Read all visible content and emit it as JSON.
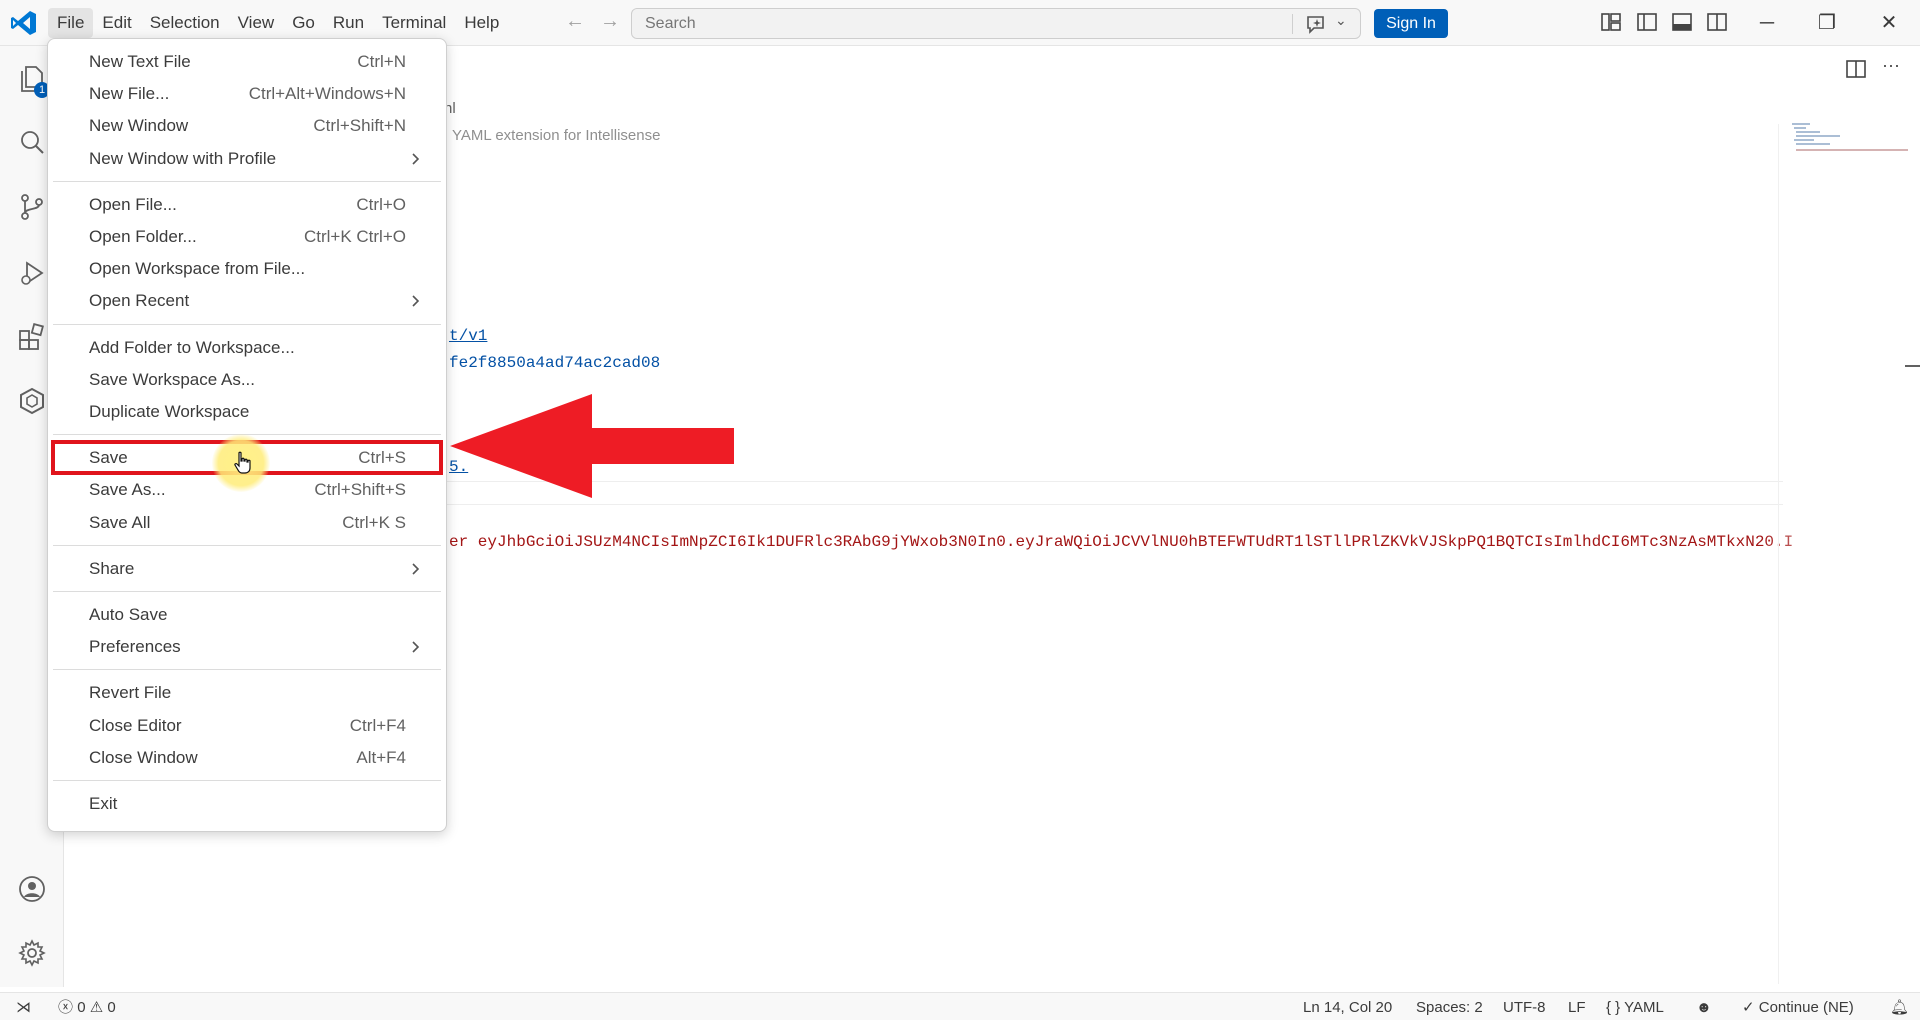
{
  "menubar": [
    "File",
    "Edit",
    "Selection",
    "View",
    "Go",
    "Run",
    "Terminal",
    "Help"
  ],
  "search": {
    "placeholder": "Search"
  },
  "signin_label": "Sign In",
  "activity": {
    "explorer_badge": "1"
  },
  "editor": {
    "breadcrumb": "nl",
    "hint": "YAML extension for Intellisense",
    "lines": [
      {
        "text": "t/v1",
        "kind": "link"
      },
      {
        "text": "fe2f8850a4ad74ac2cad08",
        "kind": "num"
      },
      {
        "text": "5.",
        "kind": "link"
      },
      {
        "text": "er eyJhbGciOiJSUzM4NCIsImNpZCI6Ik1DUFRlc3RAbG9jYWxob3N0In0.eyJraWQiOiJCVVlNU0hBTEFWTUdRT1lSTllPRlZKVkVJSkpPQ1BQTCIsImlhdCI6MTc3NzAsMTkxN20.I",
        "kind": "str"
      }
    ]
  },
  "file_menu": {
    "groups": [
      [
        {
          "label": "New Text File",
          "shortcut": "Ctrl+N"
        },
        {
          "label": "New File...",
          "shortcut": "Ctrl+Alt+Windows+N"
        },
        {
          "label": "New Window",
          "shortcut": "Ctrl+Shift+N"
        },
        {
          "label": "New Window with Profile",
          "shortcut": "",
          "submenu": true
        }
      ],
      [
        {
          "label": "Open File...",
          "shortcut": "Ctrl+O"
        },
        {
          "label": "Open Folder...",
          "shortcut": "Ctrl+K Ctrl+O"
        },
        {
          "label": "Open Workspace from File...",
          "shortcut": ""
        },
        {
          "label": "Open Recent",
          "shortcut": "",
          "submenu": true
        }
      ],
      [
        {
          "label": "Add Folder to Workspace...",
          "shortcut": ""
        },
        {
          "label": "Save Workspace As...",
          "shortcut": ""
        },
        {
          "label": "Duplicate Workspace",
          "shortcut": ""
        }
      ],
      [
        {
          "label": "Save",
          "shortcut": "Ctrl+S",
          "highlighted": true
        },
        {
          "label": "Save As...",
          "shortcut": "Ctrl+Shift+S"
        },
        {
          "label": "Save All",
          "shortcut": "Ctrl+K S"
        }
      ],
      [
        {
          "label": "Share",
          "shortcut": "",
          "submenu": true
        }
      ],
      [
        {
          "label": "Auto Save",
          "shortcut": ""
        },
        {
          "label": "Preferences",
          "shortcut": "",
          "submenu": true
        }
      ],
      [
        {
          "label": "Revert File",
          "shortcut": ""
        },
        {
          "label": "Close Editor",
          "shortcut": "Ctrl+F4"
        },
        {
          "label": "Close Window",
          "shortcut": "Alt+F4"
        }
      ],
      [
        {
          "label": "Exit",
          "shortcut": ""
        }
      ]
    ]
  },
  "statusbar": {
    "errors": "0",
    "warnings": "0",
    "position": "Ln 14, Col 20",
    "spaces": "Spaces: 2",
    "encoding": "UTF-8",
    "eol": "LF",
    "language": "YAML",
    "continue": "Continue (NE)"
  },
  "colors": {
    "accent": "#005fb8",
    "highlight": "#e0141c",
    "arrow": "#ee1c25"
  }
}
